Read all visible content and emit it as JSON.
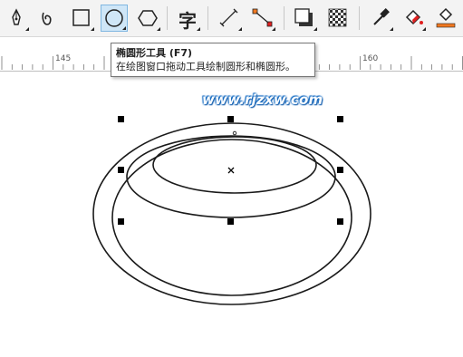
{
  "toolbar": {
    "tools": [
      {
        "name": "pen-tool",
        "icon": "pen-nib-icon"
      },
      {
        "name": "artistic-media-tool",
        "icon": "spiral-curve-icon"
      },
      {
        "name": "rectangle-tool",
        "icon": "rectangle-icon"
      },
      {
        "name": "ellipse-tool",
        "icon": "ellipse-icon",
        "active": true
      },
      {
        "name": "polygon-tool",
        "icon": "hexagon-icon"
      },
      {
        "name": "text-tool",
        "icon": "text-char-icon",
        "glyph": "字"
      },
      {
        "name": "dimension-tool",
        "icon": "dimension-line-icon"
      },
      {
        "name": "connector-tool",
        "icon": "connector-icon"
      },
      {
        "name": "drop-shadow-tool",
        "icon": "drop-shadow-icon"
      },
      {
        "name": "transparency-tool",
        "icon": "checkerboard-icon"
      },
      {
        "name": "eyedropper-tool",
        "icon": "eyedropper-icon"
      },
      {
        "name": "interactive-fill-tool",
        "icon": "paint-bucket-icon"
      },
      {
        "name": "smart-fill-tool",
        "icon": "fill-bucket-icon"
      }
    ]
  },
  "tooltip": {
    "title": "椭圆形工具 (F7)",
    "description": "在绘图窗口拖动工具绘制圆形和椭圆形。"
  },
  "ruler": {
    "labels": [
      "145",
      "160"
    ]
  },
  "watermark": "www.rjzxw.com",
  "colors": {
    "active_tool_bg": "#cfe6f7",
    "accent_red": "#e02020",
    "accent_orange": "#f07820",
    "watermark_blue": "#1a6fc4"
  }
}
